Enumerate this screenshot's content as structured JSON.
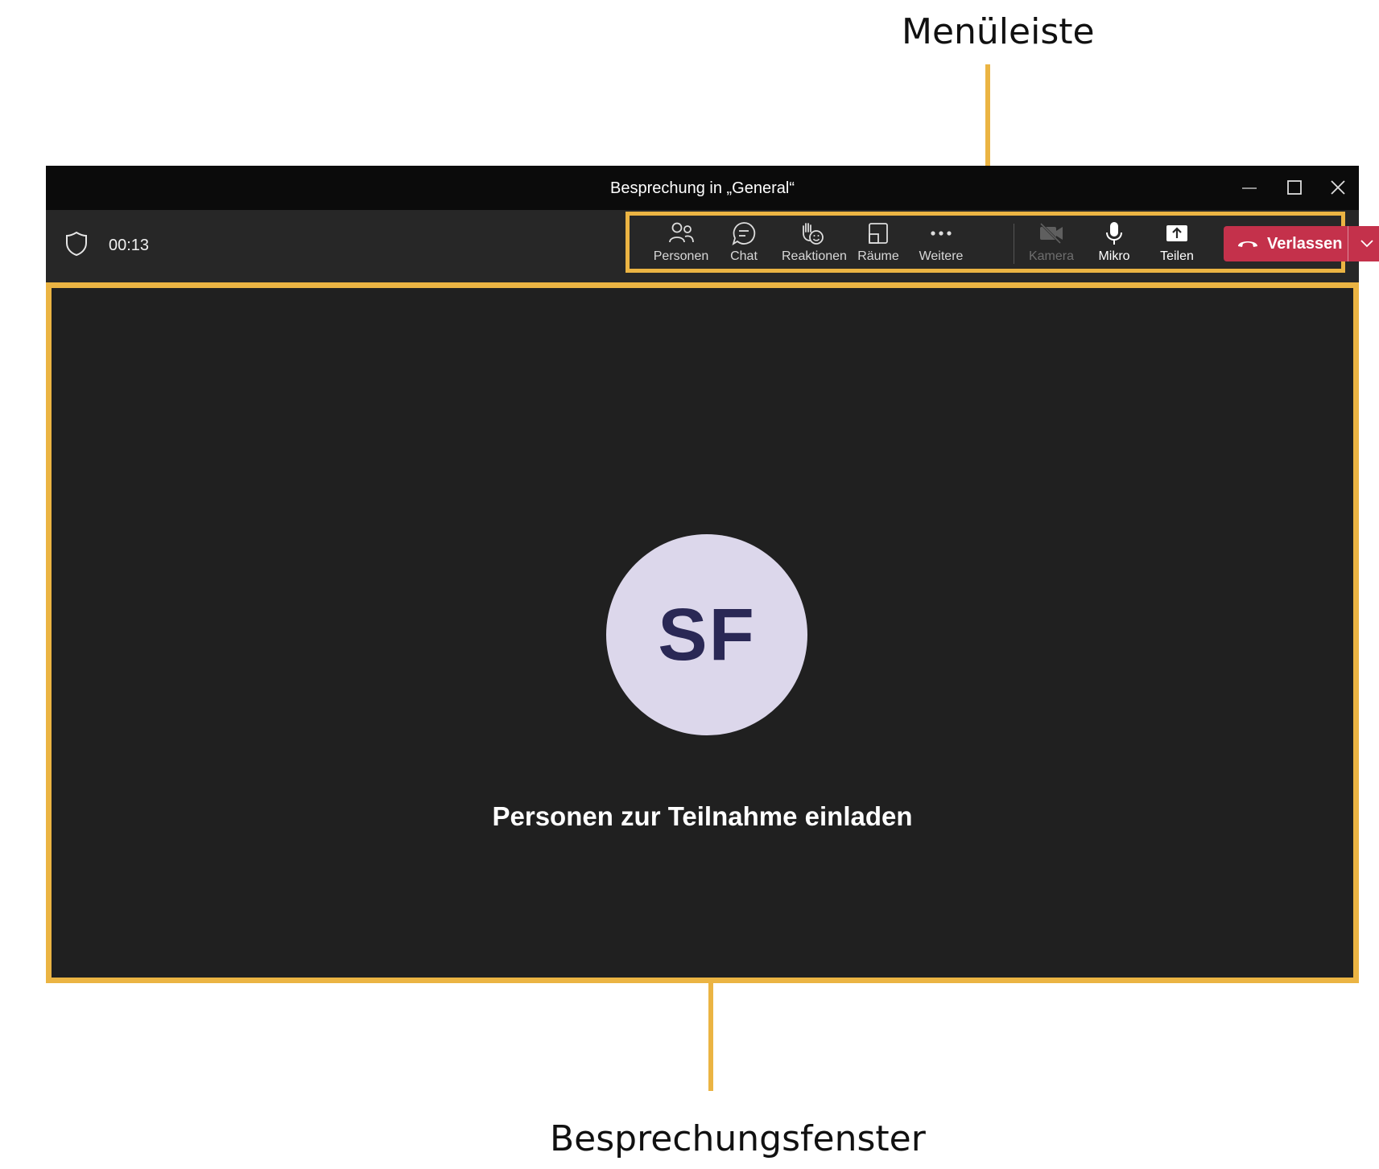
{
  "annotations": {
    "menubar_label": "Menüleiste",
    "window_label": "Besprechungsfenster",
    "highlight_color": "#ebb443"
  },
  "window": {
    "title": "Besprechung in „General“",
    "controls": [
      "minimize-icon",
      "maximize-icon",
      "close-icon"
    ]
  },
  "meeting_bar": {
    "timer": "00:13",
    "security_icon": "shield-icon",
    "tools": [
      {
        "label": "Personen",
        "icon": "people-icon"
      },
      {
        "label": "Chat",
        "icon": "chat-icon"
      },
      {
        "label": "Reaktionen",
        "icon": "hand-reaction-icon"
      },
      {
        "label": "Räume",
        "icon": "rooms-icon"
      },
      {
        "label": "Weitere",
        "icon": "more-icon"
      },
      {
        "label": "Kamera",
        "icon": "camera-off-icon",
        "state": "disabled"
      },
      {
        "label": "Mikro",
        "icon": "microphone-icon"
      },
      {
        "label": "Teilen",
        "icon": "share-icon"
      }
    ],
    "leave": {
      "label": "Verlassen",
      "color": "#c4314b"
    }
  },
  "stage": {
    "avatar_initials": "SF",
    "avatar_color": "#dcd7eb",
    "invite_text": "Personen zur Teilnahme einladen"
  }
}
